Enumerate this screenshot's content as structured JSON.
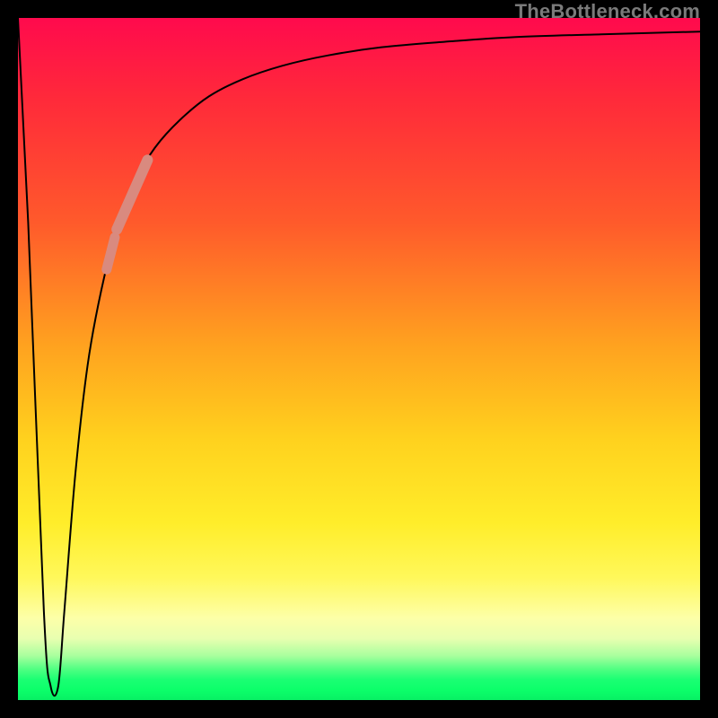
{
  "watermark": "TheBottleneck.com",
  "colors": {
    "background": "#000000",
    "curve": "#000000",
    "marker": "#d98a7f"
  },
  "chart_data": {
    "type": "line",
    "title": "",
    "xlabel": "",
    "ylabel": "",
    "xlim": [
      0,
      100
    ],
    "ylim": [
      0,
      100
    ],
    "grid": false,
    "legend": false,
    "annotations": [
      {
        "text": "TheBottleneck.com",
        "position": "top-right"
      }
    ],
    "series": [
      {
        "name": "bottleneck-curve",
        "x": [
          0.0,
          1.5,
          3.8,
          4.8,
          5.9,
          6.8,
          8.4,
          10.2,
          12.2,
          14.5,
          17.1,
          20.1,
          23.7,
          28.0,
          32.9,
          38.8,
          45.4,
          53.3,
          62.5,
          73.0,
          85.5,
          100.0
        ],
        "y": [
          100.0,
          70.0,
          13.0,
          2.0,
          2.0,
          13.0,
          33.0,
          49.0,
          60.0,
          69.0,
          76.0,
          81.0,
          85.0,
          88.5,
          91.0,
          93.0,
          94.5,
          95.7,
          96.5,
          97.2,
          97.6,
          98.0
        ]
      }
    ],
    "markers": [
      {
        "name": "highlight-segment-long",
        "on_series": "bottleneck-curve",
        "x_range": [
          14.5,
          19.0
        ],
        "style": "thick"
      },
      {
        "name": "highlight-segment-short",
        "on_series": "bottleneck-curve",
        "x_range": [
          13.0,
          14.2
        ],
        "style": "thick"
      }
    ],
    "background_gradient": {
      "direction": "vertical",
      "stops": [
        {
          "pos": 0.0,
          "color": "#ff0a4d"
        },
        {
          "pos": 0.3,
          "color": "#ff5a2b"
        },
        {
          "pos": 0.62,
          "color": "#ffd21e"
        },
        {
          "pos": 0.88,
          "color": "#fdffa8"
        },
        {
          "pos": 0.96,
          "color": "#4fff82"
        },
        {
          "pos": 1.0,
          "color": "#08f064"
        }
      ]
    }
  }
}
